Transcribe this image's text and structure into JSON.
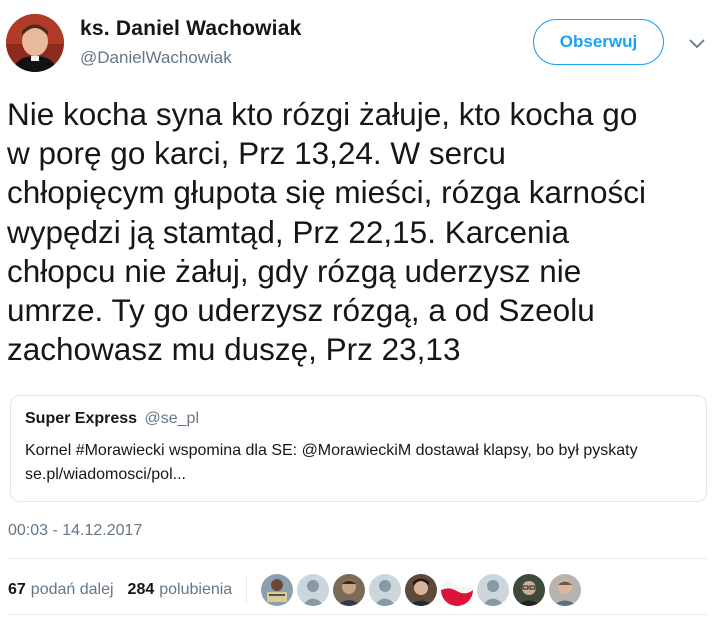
{
  "author": {
    "name": "ks. Daniel Wachowiak",
    "handle": "@DanielWachowiak"
  },
  "actions": {
    "follow_label": "Obserwuj",
    "more_icon": "chevron-down-icon"
  },
  "tweet": {
    "text_lines": [
      "Nie kocha syna kto rózgi żałuje, kto kocha go",
      "w porę go karci, Prz 13,24. W sercu",
      "chłopięcym głupota się mieści, rózga karności",
      "wypędzi ją stamtąd, Prz 22,15. Karcenia",
      "chłopcu nie żałuj, gdy rózgą uderzysz nie",
      "umrze. Ty go uderzysz rózgą, a od Szeolu",
      "zachowasz mu duszę, Prz 23,13"
    ]
  },
  "quote": {
    "name": "Super Express",
    "handle": "@se_pl",
    "text_line_1": "Kornel #Morawiecki wspomina dla SE: @MorawieckiM dostawał klapsy, bo był pyskaty",
    "text_line_2": "se.pl/wiadomosci/pol..."
  },
  "timestamp": "00:03 - 14.12.2017",
  "stats": {
    "retweets_count": "67",
    "retweets_label": "podań dalej",
    "likes_count": "284",
    "likes_label": "polubienia"
  },
  "colors": {
    "accent": "#1da1f2",
    "text": "#14171a",
    "muted": "#657786",
    "border": "#e1e8ed"
  }
}
